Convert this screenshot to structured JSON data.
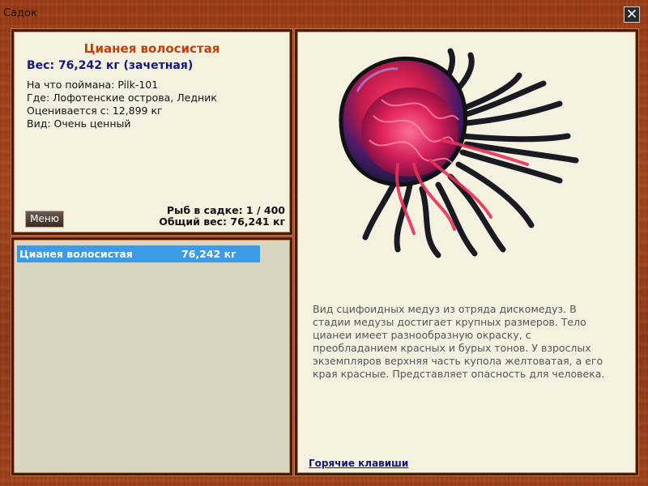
{
  "window": {
    "title": "Садок",
    "close_symbol": "✕"
  },
  "fish": {
    "name": "Цианея волосистая",
    "weight_text": "Вес: 76,242 кг (зачетная)",
    "caught_on": "На что поймана: Pilk-101",
    "location": "Где: Лофотенские острова, Ледник",
    "valued_from": "Оценивается с: 12,899 кг",
    "kind": "Вид: Очень ценный",
    "description": "Вид сцифоидных медуз из отряда дискомедуз. В стадии медузы достигает крупных размеров. Тело цианеи имеет разнообразную окраску, с преобладанием красных и бурых тонов. У взрослых экземпляров верхняя часть купола желтоватая, а его края красные. Представляет опасность для человека."
  },
  "keepnet": {
    "menu_label": "Меню",
    "fish_count": "Рыб в садке: 1 / 400",
    "total_weight": "Общий вес: 76,241 кг",
    "items": [
      {
        "name": "Цианея волосистая",
        "weight": "76,242 кг"
      }
    ]
  },
  "footer": {
    "hotkeys_label": "Горячие клавиши"
  },
  "icons": {
    "close": "close-icon",
    "fish_picture": "jellyfish-illustration"
  },
  "colors": {
    "fish_name": "#c0400b",
    "weight": "#15187a",
    "selection": "#3c9be6",
    "link": "#12167a"
  }
}
